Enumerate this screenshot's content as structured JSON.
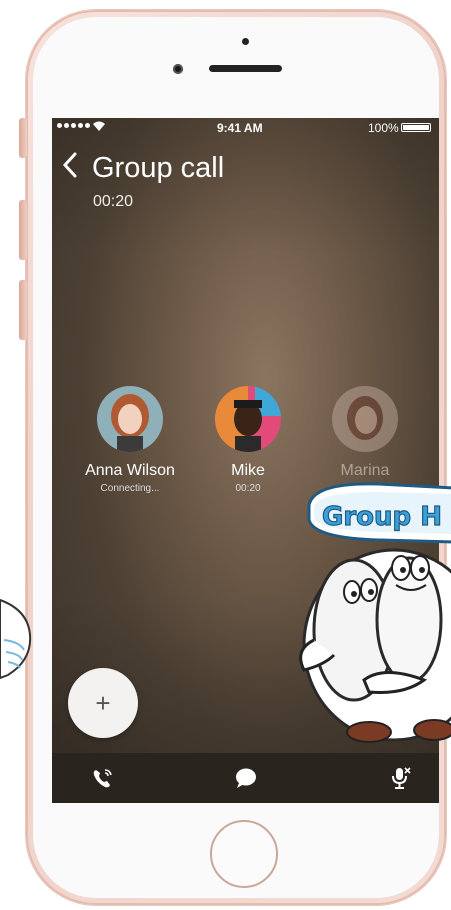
{
  "status_bar": {
    "time": "9:41 AM",
    "battery": "100%"
  },
  "header": {
    "back_label": "<",
    "title": "Group call",
    "timer": "00:20"
  },
  "participants": [
    {
      "name": "Anna Wilson",
      "status": "Connecting..."
    },
    {
      "name": "Mike",
      "status": "00:20"
    },
    {
      "name": "Marina",
      "status": ""
    }
  ],
  "add_button": {
    "label": "+"
  },
  "tabbar": {
    "icons": [
      "call-icon",
      "chat-icon",
      "mute-mic-icon"
    ]
  },
  "sticker": {
    "text": "Group H"
  },
  "colors": {
    "phone_body": "#efd2c9",
    "tabbar": "#2a241f",
    "sticker_text": "#3aa0d8"
  }
}
